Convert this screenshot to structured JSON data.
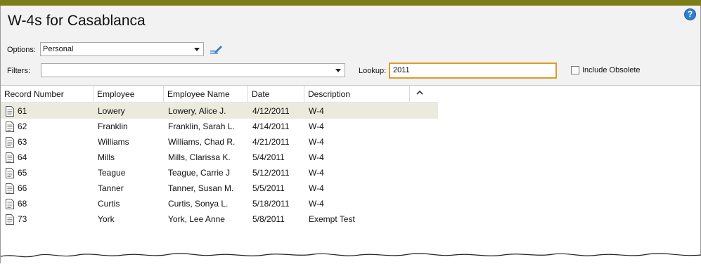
{
  "window": {
    "title": "W-4s for Casablanca",
    "help_glyph": "?"
  },
  "toolbar": {
    "options_label": "Options:",
    "options_value": "Personal",
    "filters_label": "Filters:",
    "filters_value": "",
    "lookup_label": "Lookup:",
    "lookup_value": "2011",
    "include_obsolete_label": "Include Obsolete",
    "include_obsolete_checked": false
  },
  "grid": {
    "columns": [
      "Record Number",
      "Employee",
      "Employee Name",
      "Date",
      "Description"
    ],
    "rows": [
      {
        "record": "61",
        "employee": "Lowery",
        "name": "Lowery, Alice J.",
        "date": "4/12/2011",
        "description": "W-4",
        "selected": true
      },
      {
        "record": "62",
        "employee": "Franklin",
        "name": "Franklin, Sarah L.",
        "date": "4/14/2011",
        "description": "W-4"
      },
      {
        "record": "63",
        "employee": "Williams",
        "name": "Williams, Chad R.",
        "date": "4/21/2011",
        "description": "W-4"
      },
      {
        "record": "64",
        "employee": "Mills",
        "name": "Mills, Clarissa K.",
        "date": "5/4/2011",
        "description": "W-4"
      },
      {
        "record": "65",
        "employee": "Teague",
        "name": "Teague, Carrie J",
        "date": "5/12/2011",
        "description": "W-4"
      },
      {
        "record": "66",
        "employee": "Tanner",
        "name": "Tanner, Susan M.",
        "date": "5/5/2011",
        "description": "W-4"
      },
      {
        "record": "68",
        "employee": "Curtis",
        "name": "Curtis, Sonya L.",
        "date": "5/18/2011",
        "description": "W-4"
      },
      {
        "record": "73",
        "employee": "York",
        "name": "York, Lee Anne",
        "date": "5/8/2011",
        "description": "Exempt Test"
      }
    ]
  },
  "colors": {
    "accent_bar": "#7d7d18",
    "lookup_focus_border": "#e09b2b",
    "selected_row": "#ebebdd",
    "help_icon": "#2f7fd1"
  }
}
